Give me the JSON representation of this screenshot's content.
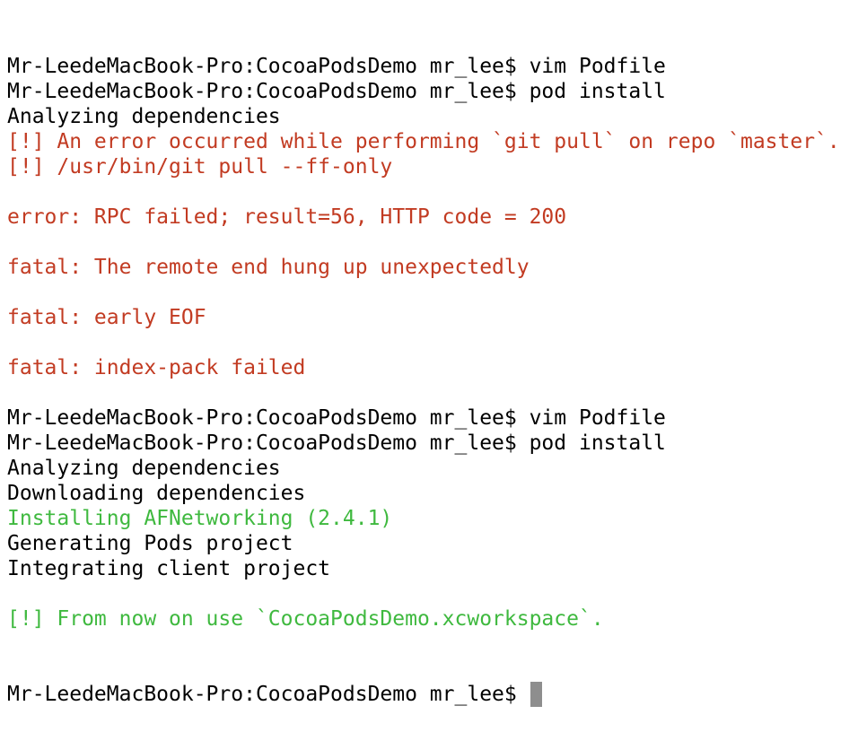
{
  "terminal": {
    "prompt": "Mr-LeedeMacBook-Pro:CocoaPodsDemo mr_lee$ ",
    "colors": {
      "error": "#c23b22",
      "success": "#3fb93f",
      "cursor": "#8e8e8e"
    },
    "lines": [
      {
        "text": "Mr-LeedeMacBook-Pro:CocoaPodsDemo mr_lee$ vim Podfile",
        "style": "normal"
      },
      {
        "text": "Mr-LeedeMacBook-Pro:CocoaPodsDemo mr_lee$ pod install",
        "style": "normal"
      },
      {
        "text": "Analyzing dependencies",
        "style": "normal"
      },
      {
        "text": "[!] An error occurred while performing `git pull` on repo `master`.",
        "style": "error"
      },
      {
        "text": "[!] /usr/bin/git pull --ff-only",
        "style": "error"
      },
      {
        "text": "",
        "style": "error"
      },
      {
        "text": "error: RPC failed; result=56, HTTP code = 200",
        "style": "error"
      },
      {
        "text": "",
        "style": "error"
      },
      {
        "text": "fatal: The remote end hung up unexpectedly",
        "style": "error"
      },
      {
        "text": "",
        "style": "error"
      },
      {
        "text": "fatal: early EOF",
        "style": "error"
      },
      {
        "text": "",
        "style": "error"
      },
      {
        "text": "fatal: index-pack failed",
        "style": "error"
      },
      {
        "text": "",
        "style": "normal"
      },
      {
        "text": "Mr-LeedeMacBook-Pro:CocoaPodsDemo mr_lee$ vim Podfile",
        "style": "normal"
      },
      {
        "text": "Mr-LeedeMacBook-Pro:CocoaPodsDemo mr_lee$ pod install",
        "style": "normal"
      },
      {
        "text": "Analyzing dependencies",
        "style": "normal"
      },
      {
        "text": "Downloading dependencies",
        "style": "normal"
      },
      {
        "text": "Installing AFNetworking (2.4.1)",
        "style": "success"
      },
      {
        "text": "Generating Pods project",
        "style": "normal"
      },
      {
        "text": "Integrating client project",
        "style": "normal"
      },
      {
        "text": "",
        "style": "normal"
      },
      {
        "text": "[!] From now on use `CocoaPodsDemo.xcworkspace`.",
        "style": "success"
      }
    ]
  }
}
